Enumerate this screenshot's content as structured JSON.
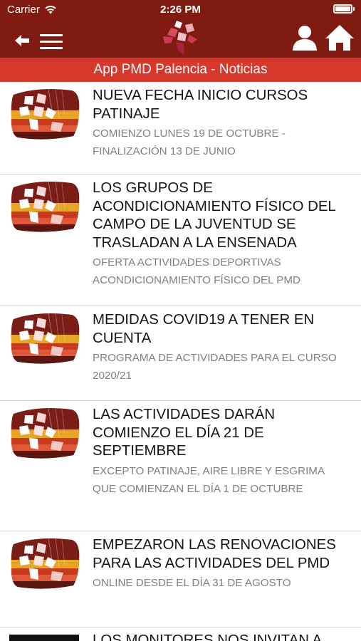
{
  "status_bar": {
    "carrier": "Carrier",
    "time": "2:26 PM"
  },
  "header": {
    "title": "App PMD Palencia - Noticias",
    "colors": {
      "bar": "#7f1b10",
      "title_bar": "#d6392b"
    }
  },
  "news": [
    {
      "headline": "NUEVA FECHA INICIO CURSOS PATINAJE",
      "subtext": "COMIENZO LUNES 19 DE OCTUBRE - FINALIZACIÓN 13 DE JUNIO"
    },
    {
      "headline": "LOS GRUPOS DE ACONDICIONAMIENTO FÍSICO DEL CAMPO DE LA JUVENTUD SE TRASLADAN A LA ENSENADA",
      "subtext": "OFERTA ACTIVIDADES DEPORTIVAS ACONDICIONAMIENTO FÍSICO DEL PMD"
    },
    {
      "headline": "MEDIDAS COVID19 A TENER EN CUENTA",
      "subtext": "PROGRAMA DE ACTIVIDADES PARA EL CURSO 2020/21"
    },
    {
      "headline": "LAS ACTIVIDADES DARÁN COMIENZO EL DÍA 21 DE SEPTIEMBRE",
      "subtext": "EXCEPTO PATINAJE, AIRE LIBRE Y ESGRIMA QUE COMIENZAN EL DÍA 1 DE OCTUBRE"
    },
    {
      "headline": "EMPEZARON LAS RENOVACIONES PARA LAS ACTIVIDADES DEL PMD",
      "subtext": "ONLINE DESDE EL DÍA 31 DE AGOSTO"
    }
  ],
  "partial_item": {
    "headline": "LOS MONITORES NOS INVITAN A"
  },
  "icons": [
    "wifi-icon",
    "battery-icon",
    "back-arrow-icon",
    "hamburger-menu-icon",
    "pmd-logo",
    "user-icon",
    "home-icon"
  ]
}
